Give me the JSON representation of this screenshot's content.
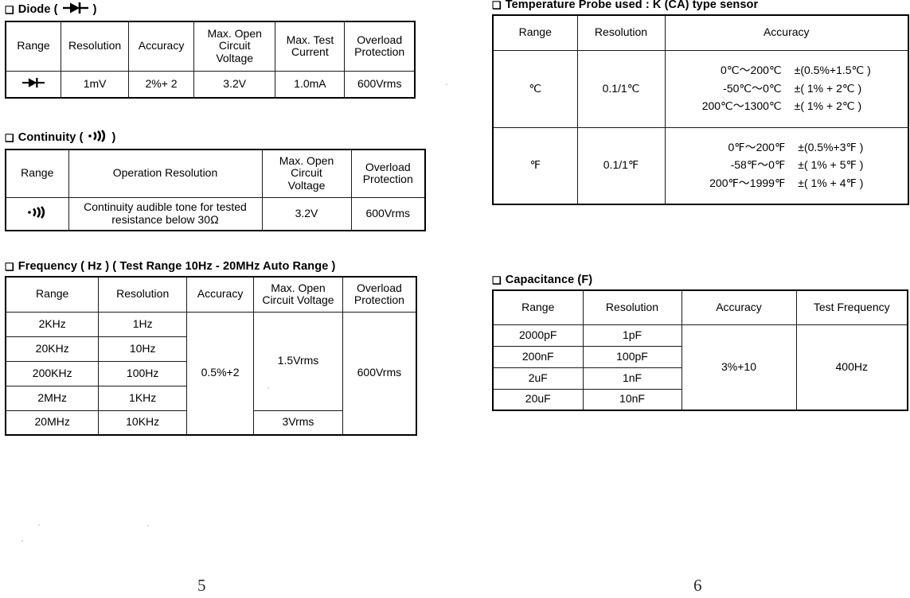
{
  "page": {
    "left_page_number": "5",
    "right_page_number": "6",
    "bullet": "❑"
  },
  "sections": {
    "diode": {
      "heading_prefix": "Diode (",
      "heading_suffix": ")",
      "symbol_name": "diode-symbol",
      "headers": [
        "Range",
        "Resolution",
        "Accuracy",
        "Max. Open Circuit Voltage",
        "Max. Test Current",
        "Overload Protection"
      ],
      "headers_wrapped": {
        "range": "Range",
        "resolution": "Resolution",
        "accuracy": "Accuracy",
        "max_open_circuit_voltage_l1": "Max. Open",
        "max_open_circuit_voltage_l2": "Circuit",
        "max_open_circuit_voltage_l3": "Voltage",
        "max_test_current_l1": "Max. Test",
        "max_test_current_l2": "Current",
        "overload_protection_l1": "Overload",
        "overload_protection_l2": "Protection"
      },
      "row": {
        "range": "",
        "resolution": "1mV",
        "accuracy": "2%+ 2",
        "max_open_circuit_voltage": "3.2V",
        "max_test_current": "1.0mA",
        "overload_protection": "600Vrms"
      }
    },
    "continuity": {
      "heading_prefix": "Continuity (",
      "heading_suffix": ")",
      "symbol_name": "buzzer-symbol",
      "headers_wrapped": {
        "range": "Range",
        "operation_resolution": "Operation Resolution",
        "max_open_circuit_voltage_l1": "Max. Open",
        "max_open_circuit_voltage_l2": "Circuit",
        "max_open_circuit_voltage_l3": "Voltage",
        "overload_protection_l1": "Overload",
        "overload_protection_l2": "Protection"
      },
      "row": {
        "range": "",
        "operation_resolution_l1": "Continuity audible tone for tested",
        "operation_resolution_l2": "resistance below 30Ω",
        "max_open_circuit_voltage": "3.2V",
        "overload_protection": "600Vrms"
      }
    },
    "frequency": {
      "heading": "Frequency ( Hz ) ( Test Range 10Hz - 20MHz Auto Range )",
      "headers_wrapped": {
        "range": "Range",
        "resolution": "Resolution",
        "accuracy": "Accuracy",
        "max_open_circuit_voltage_l1": "Max. Open",
        "max_open_circuit_voltage_l2": "Circuit Voltage",
        "overload_protection_l1": "Overload",
        "overload_protection_l2": "Protection"
      },
      "rows": [
        {
          "range": "2KHz",
          "resolution": "1Hz"
        },
        {
          "range": "20KHz",
          "resolution": "10Hz"
        },
        {
          "range": "200KHz",
          "resolution": "100Hz"
        },
        {
          "range": "2MHz",
          "resolution": "1KHz"
        },
        {
          "range": "20MHz",
          "resolution": "10KHz"
        }
      ],
      "accuracy": "0.5%+2",
      "max_open_circuit_voltage_top": "1.5Vrms",
      "max_open_circuit_voltage_bottom": "3Vrms",
      "overload_protection": "600Vrms"
    },
    "temperature": {
      "heading": "Temperature Probe used : K (CA) type sensor",
      "headers_wrapped": {
        "range": "Range",
        "resolution": "Resolution",
        "accuracy": "Accuracy"
      },
      "rows": [
        {
          "range": "℃",
          "resolution": "0.1/1℃",
          "accuracy_lines": [
            {
              "range": "0℃～200℃",
              "tolerance": "±(0.5%+1.5℃ )"
            },
            {
              "range": "-50℃～0℃",
              "tolerance": "±( 1%  +  2℃ )"
            },
            {
              "range": "200℃～1300℃",
              "tolerance": "±( 1%  +  2℃ )"
            }
          ]
        },
        {
          "range": "℉",
          "resolution": "0.1/1℉",
          "accuracy_lines": [
            {
              "range": "0℉～200℉",
              "tolerance": "±(0.5%+3℉ )"
            },
            {
              "range": "-58℉～0℉",
              "tolerance": "±( 1%  + 5℉ )"
            },
            {
              "range": "200℉～1999℉",
              "tolerance": "±( 1%  + 4℉ )"
            }
          ]
        }
      ]
    },
    "capacitance": {
      "heading": "Capacitance (F)",
      "headers_wrapped": {
        "range": "Range",
        "resolution": "Resolution",
        "accuracy": "Accuracy",
        "test_frequency": "Test Frequency"
      },
      "rows": [
        {
          "range": "2000pF",
          "resolution": "1pF"
        },
        {
          "range": "200nF",
          "resolution": "100pF"
        },
        {
          "range": "2uF",
          "resolution": "1nF"
        },
        {
          "range": "20uF",
          "resolution": "10nF"
        }
      ],
      "accuracy": "3%+10",
      "test_frequency": "400Hz"
    }
  }
}
